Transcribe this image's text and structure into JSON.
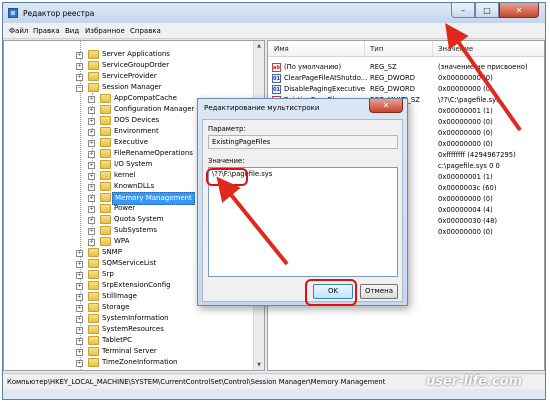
{
  "window": {
    "title": "Редактор реестра",
    "buttons": {
      "minimize": "–",
      "maximize": "□",
      "close": "✕"
    }
  },
  "menu": [
    "Файл",
    "Правка",
    "Вид",
    "Избранное",
    "Справка"
  ],
  "tree": {
    "items": [
      {
        "label": "Server Applications",
        "level": 0
      },
      {
        "label": "ServiceGroupOrder",
        "level": 0
      },
      {
        "label": "ServiceProvider",
        "level": 0
      },
      {
        "label": "Session Manager",
        "level": 0,
        "expanded": true
      },
      {
        "label": "AppCompatCache",
        "level": 1
      },
      {
        "label": "Configuration Manager",
        "level": 1
      },
      {
        "label": "DOS Devices",
        "level": 1
      },
      {
        "label": "Environment",
        "level": 1
      },
      {
        "label": "Executive",
        "level": 1
      },
      {
        "label": "FileRenameOperations",
        "level": 1
      },
      {
        "label": "I/O System",
        "level": 1
      },
      {
        "label": "kernel",
        "level": 1
      },
      {
        "label": "KnownDLLs",
        "level": 1
      },
      {
        "label": "Memory Management",
        "level": 1,
        "selected": true
      },
      {
        "label": "Power",
        "level": 1
      },
      {
        "label": "Quota System",
        "level": 1
      },
      {
        "label": "SubSystems",
        "level": 1
      },
      {
        "label": "WPA",
        "level": 1
      },
      {
        "label": "SNMP",
        "level": 0
      },
      {
        "label": "SQMServiceList",
        "level": 0
      },
      {
        "label": "Srp",
        "level": 0
      },
      {
        "label": "SrpExtensionConfig",
        "level": 0
      },
      {
        "label": "StillImage",
        "level": 0
      },
      {
        "label": "Storage",
        "level": 0
      },
      {
        "label": "SystemInformation",
        "level": 0
      },
      {
        "label": "SystemResources",
        "level": 0
      },
      {
        "label": "TabletPC",
        "level": 0
      },
      {
        "label": "Terminal Server",
        "level": 0
      },
      {
        "label": "TimeZoneInformation",
        "level": 0
      }
    ]
  },
  "list": {
    "headers": {
      "name": "Имя",
      "type": "Тип",
      "value": "Значение"
    },
    "rows": [
      {
        "name": "(По умолчанию)",
        "type": "REG_SZ",
        "value": "(значение не присвоено)",
        "icon": "str"
      },
      {
        "name": "ClearPageFileAtShutdo...",
        "type": "REG_DWORD",
        "value": "0x00000000 (0)",
        "icon": "bin"
      },
      {
        "name": "DisablePagingExecutive",
        "type": "REG_DWORD",
        "value": "0x00000000 (0)",
        "icon": "bin"
      },
      {
        "name": "ExistingPageFiles",
        "type": "REG_MULTI_SZ",
        "value": "\\??\\C:\\pagefile.sys",
        "icon": "str"
      },
      {
        "name": "",
        "type": "",
        "value": "0x00000001 (1)",
        "icon": "bin"
      },
      {
        "name": "",
        "type": "",
        "value": "0x00000000 (0)",
        "icon": "bin"
      },
      {
        "name": "",
        "type": "",
        "value": "0x00000000 (0)",
        "icon": "bin"
      },
      {
        "name": "",
        "type": "",
        "value": "0x00000000 (0)",
        "icon": "bin"
      },
      {
        "name": "",
        "type": "",
        "value": "0xffffffff (4294967295)",
        "icon": "bin"
      },
      {
        "name": "",
        "type": "",
        "value": "c:\\pagefile.sys 0 0",
        "icon": "str"
      },
      {
        "name": "",
        "type": "",
        "value": "0x00000001 (1)",
        "icon": "bin"
      },
      {
        "name": "",
        "type": "",
        "value": "0x0000003c (60)",
        "icon": "bin"
      },
      {
        "name": "",
        "type": "",
        "value": "0x00000000 (0)",
        "icon": "bin"
      },
      {
        "name": "",
        "type": "",
        "value": "0x00000004 (4)",
        "icon": "bin"
      },
      {
        "name": "",
        "type": "",
        "value": "0x00000030 (48)",
        "icon": "bin"
      },
      {
        "name": "",
        "type": "",
        "value": "0x00000000 (0)",
        "icon": "bin"
      }
    ]
  },
  "status": "Компьютер\\HKEY_LOCAL_MACHINE\\SYSTEM\\CurrentControlSet\\Control\\Session Manager\\Memory Management",
  "dialog": {
    "title": "Редактирование мультистроки",
    "param_label": "Параметр:",
    "param_value": "ExistingPageFiles",
    "value_label": "Значение:",
    "value_text": "\\??\\F:\\pagefile.sys",
    "ok": "OK",
    "cancel": "Отмена",
    "close": "✕"
  },
  "watermark": "user-life.com",
  "colors": {
    "selection": "#3399ff",
    "highlight": "#dd1111",
    "folder": "#e7c14b"
  }
}
